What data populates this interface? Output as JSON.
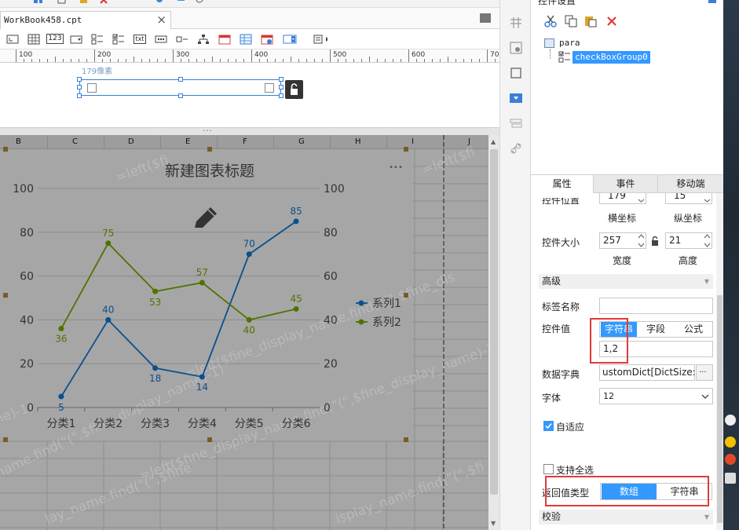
{
  "editor": {
    "file_tab": "WorkBook458.cpt",
    "close_glyph": "×",
    "ruler_labels": [
      "100",
      "200",
      "300",
      "400",
      "500",
      "600",
      "70"
    ],
    "pixel_label": "179像素",
    "toolbar_text_icon": "123",
    "toolbar_txt_icon": "txt",
    "collapse_dots": "...",
    "columns": [
      "B",
      "C",
      "D",
      "E",
      "F",
      "G",
      "H",
      "I",
      "J"
    ]
  },
  "watermark": {
    "t1": "=left($fi",
    "t2": "_name.find(\"(\",$fine_display_name)-1)",
    "t3": "=left($fine_display_name,find(\"(\",$fine_dis",
    "t4": "me)-1)",
    "t5": "=left($fine_display_name,find(\"(\",$fine_display_name)-1)",
    "t6": "lay_name.find(\"(\",$fine",
    "t7": "isplay_name.find(\"(\",$fi",
    "t8": "=left($fi"
  },
  "chart_data": {
    "type": "line",
    "title": "新建图表标题",
    "more_glyph": "•••",
    "categories": [
      "分类1",
      "分类2",
      "分类3",
      "分类4",
      "分类5",
      "分类6"
    ],
    "series": [
      {
        "name": "系列1",
        "color": "#0a4f8f",
        "values": [
          5,
          40,
          18,
          14,
          70,
          85
        ]
      },
      {
        "name": "系列2",
        "color": "#4f7300",
        "values": [
          36,
          75,
          53,
          57,
          40,
          45
        ]
      }
    ],
    "y_ticks": [
      "0",
      "20",
      "40",
      "60",
      "80",
      "100"
    ],
    "ylim": [
      0,
      100
    ],
    "grid": true,
    "legend_position": "right",
    "secondary_axis": true
  },
  "panel": {
    "title": "控件设置",
    "tree_root": "para",
    "tree_child": "checkBoxGroup0",
    "tabs": [
      "属性",
      "事件",
      "移动端"
    ],
    "position_label": "控件位置",
    "pos_x": "179",
    "pos_y": "15",
    "x_label": "横坐标",
    "y_label": "纵坐标",
    "size_label": "控件大小",
    "width_value": "257",
    "height_value": "21",
    "width_label": "宽度",
    "height_label": "高度",
    "advanced_section": "高级",
    "tag_name_label": "标签名称",
    "tag_name_value": "",
    "control_value_label": "控件值",
    "value_types": [
      "字符串",
      "字段",
      "公式"
    ],
    "control_value": "1,2",
    "dict_label": "数据字典",
    "dict_value": "ustomDict[DictSize:3]",
    "dict_more": "···",
    "font_label": "字体",
    "font_value": "12",
    "autofit_label": "自适应",
    "select_all_label": "支持全选",
    "return_type_label": "返回值类型",
    "return_types": [
      "数组",
      "字符串"
    ],
    "validate_section": "校验",
    "colors": {
      "accent": "#3399ff",
      "highlight": "#e23a3a"
    }
  }
}
